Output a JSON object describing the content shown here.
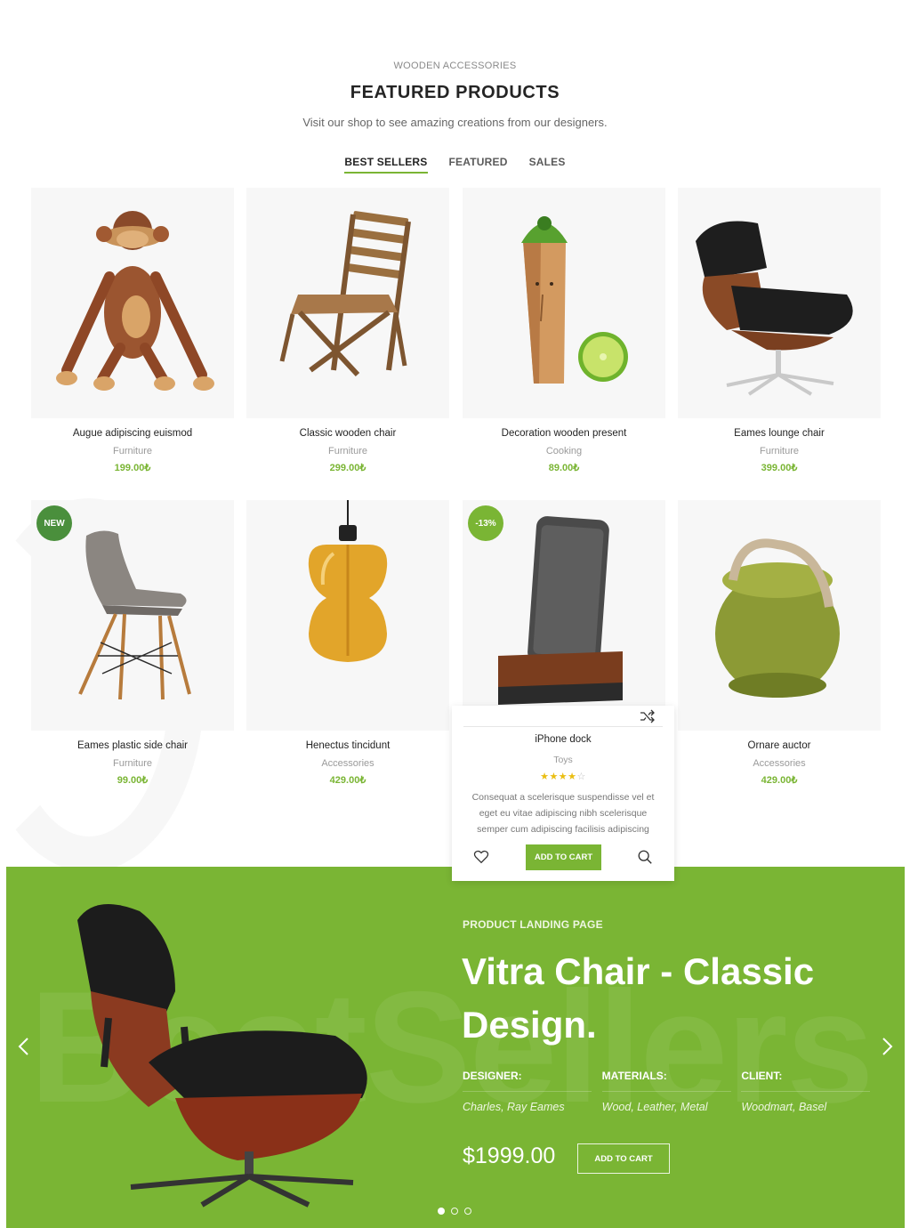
{
  "header": {
    "subtitle": "WOODEN ACCESSORIES",
    "title": "FEATURED PRODUCTS",
    "description": "Visit our shop to see amazing creations from our designers."
  },
  "tabs": [
    {
      "label": "BEST SELLERS",
      "active": true
    },
    {
      "label": "FEATURED",
      "active": false
    },
    {
      "label": "SALES",
      "active": false
    }
  ],
  "products": [
    {
      "name": "Augue adipiscing euismod",
      "category": "Furniture",
      "price": "199.00₺"
    },
    {
      "name": "Classic wooden chair",
      "category": "Furniture",
      "price": "299.00₺"
    },
    {
      "name": "Decoration wooden present",
      "category": "Cooking",
      "price": "89.00₺"
    },
    {
      "name": "Eames lounge chair",
      "category": "Furniture",
      "price": "399.00₺"
    },
    {
      "name": "Eames plastic side chair",
      "category": "Furniture",
      "price": "99.00₺",
      "badge": "NEW"
    },
    {
      "name": "Henectus tincidunt",
      "category": "Accessories",
      "price": "429.00₺"
    },
    {
      "name": "iPhone dock",
      "category": "Toys",
      "price": "",
      "badge": "-13%"
    },
    {
      "name": "Ornare auctor",
      "category": "Accessories",
      "price": "429.00₺"
    }
  ],
  "hover_card": {
    "name": "iPhone dock",
    "category": "Toys",
    "rating": 4,
    "rating_max": 5,
    "description": "Consequat a scelerisque suspendisse vel et eget eu vitae adipiscing nibh scelerisque semper cum adipiscing facilisis adipiscing",
    "add_to_cart_label": "ADD TO CART",
    "icons": [
      "shuffle-icon",
      "heart-icon",
      "search-icon"
    ]
  },
  "banner": {
    "watermark": "BestSellers",
    "kicker": "PRODUCT LANDING PAGE",
    "heading": "Vitra Chair - Classic Design.",
    "designer_label": "DESIGNER:",
    "designer_value": "Charles, Ray Eames",
    "materials_label": "MATERIALS:",
    "materials_value": "Wood, Leather, Metal",
    "client_label": "CLIENT:",
    "client_value": "Woodmart, Basel",
    "price": "$1999.00",
    "button_label": "ADD TO CART",
    "slides": 3,
    "active_slide": 1
  },
  "colors": {
    "accent": "#7ab534",
    "badge_new": "#4a8f3c",
    "badge_sale": "#7ab534",
    "star": "#eabe12"
  }
}
